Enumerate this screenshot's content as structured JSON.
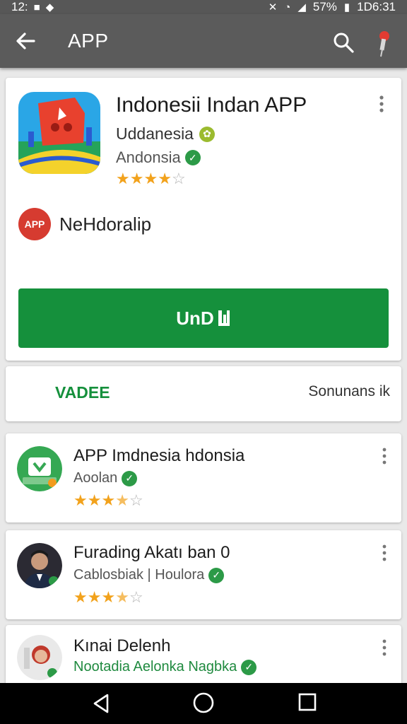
{
  "status_bar": {
    "time_left": "12:",
    "battery": "57%",
    "clock": "1D6:31"
  },
  "app_bar": {
    "title": "APP"
  },
  "app": {
    "title": "Indonesii Indan APP",
    "developer": "Uddanesia",
    "category": "Andonsia",
    "rating_stars": 4,
    "maker_badge": "APP",
    "maker_label": "NeHdoralip",
    "install_label": "UnD"
  },
  "tabs": {
    "left": "VADEE",
    "right": "Sonunans ik"
  },
  "related": [
    {
      "name": "APP Imdnesia hdonsia",
      "sub": "Aoolan",
      "rating_stars": 3.5
    },
    {
      "name": "Furading Akatı ban 0",
      "sub": "Cablosbiak | Houlora",
      "rating_stars": 3.5
    },
    {
      "name": "Kınai Delenh",
      "sub": "Nootadia Aelonka Nagbka"
    }
  ],
  "colors": {
    "accent_green": "#15903c",
    "app_bar": "#5b5b5b",
    "star": "#f2a21c",
    "maker_red": "#d63b30"
  },
  "icons": [
    "back-arrow-icon",
    "search-icon",
    "pin-icon",
    "more-vert-icon",
    "verified-icon",
    "nav-back-icon",
    "nav-home-icon",
    "nav-recents-icon"
  ]
}
